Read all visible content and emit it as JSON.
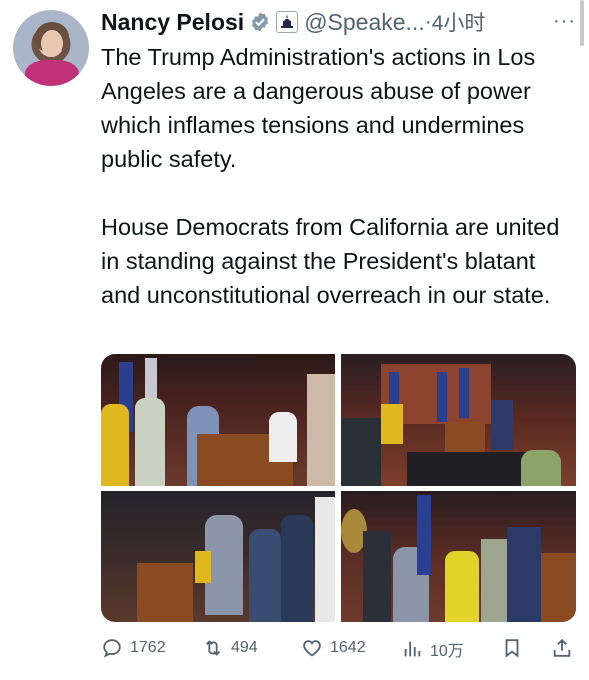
{
  "tweet": {
    "author_name": "Nancy Pelosi",
    "handle": "@Speake...",
    "separator": "·",
    "time": "4小时",
    "more": "···",
    "paragraphs": [
      "The Trump Administration's actions in Los Angeles are a dangerous abuse of power which inflames tensions and undermines public safety.",
      "House Democrats from California are united in standing against the President's blatant and unconstitutional overreach in our state."
    ]
  },
  "media": {
    "photos": [
      "photo-1",
      "photo-2",
      "photo-3",
      "photo-4"
    ]
  },
  "actions": {
    "replies": "1762",
    "reposts": "494",
    "likes": "1642",
    "views": "10万"
  },
  "colors": {
    "text": "#0f1419",
    "muted": "#536471",
    "verified": "#829aab"
  },
  "icons": [
    "verified-badge-icon",
    "capitol-icon",
    "reply-icon",
    "repost-icon",
    "like-icon",
    "views-icon",
    "bookmark-icon",
    "share-icon"
  ]
}
